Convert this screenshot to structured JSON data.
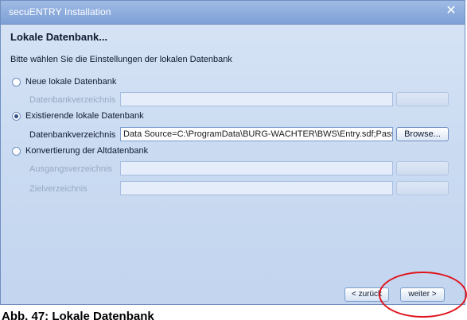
{
  "window": {
    "title": "secuENTRY Installation",
    "close_icon": "close-icon"
  },
  "page": {
    "title": "Lokale Datenbank...",
    "description": "Bitte wählen Sie die Einstellungen der lokalen Datenbank"
  },
  "options": {
    "new_db": {
      "label": "Neue lokale Datenbank",
      "selected": false,
      "dir_label": "Datenbankverzeichnis",
      "dir_value": "",
      "browse_label": "Browse..."
    },
    "existing_db": {
      "label": "Existierende lokale Datenbank",
      "selected": true,
      "dir_label": "Datenbankverzeichnis",
      "dir_value": "Data Source=C:\\ProgramData\\BURG-WACHTER\\BWS\\Entry.sdf;Pass",
      "browse_label": "Browse..."
    },
    "convert_db": {
      "label": "Konvertierung der Altdatenbank",
      "selected": false,
      "source_label": "Ausgangsverzeichnis",
      "source_value": "",
      "target_label": "Zielverzeichnis",
      "target_value": "",
      "browse_label": "Browse..."
    }
  },
  "navigation": {
    "back_label": "< zurück",
    "next_label": "weiter >"
  },
  "caption": "Abb. 47: Lokale Datenbank",
  "colors": {
    "highlight": "#e0141c",
    "titlebar": "#8aaadc"
  }
}
